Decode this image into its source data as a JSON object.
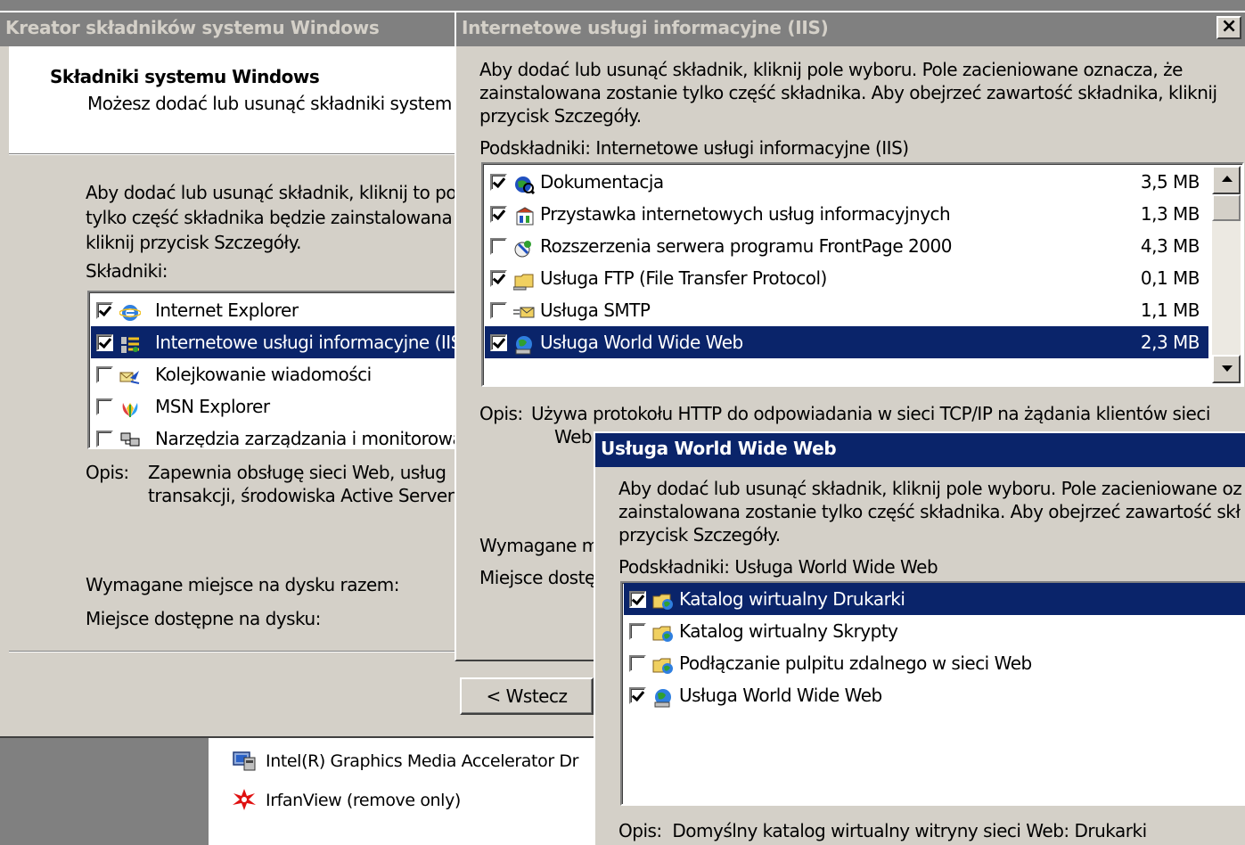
{
  "wizard": {
    "title": "Kreator składników systemu Windows",
    "header_title": "Składniki systemu Windows",
    "header_subtitle": "Możesz dodać lub usunąć składniki system",
    "intro_line1": "Aby dodać lub usunąć składnik, kliknij to po",
    "intro_line2": "tylko część składnika będzie zainstalowana",
    "intro_line3": "kliknij przycisk Szczegóły.",
    "components_label": "Składniki:",
    "components": [
      {
        "label": "Internet Explorer",
        "checked": true,
        "icon": "internet-explorer-icon"
      },
      {
        "label": "Internetowe usługi informacyjne (IIS",
        "checked": true,
        "icon": "iis-icon",
        "selected": true
      },
      {
        "label": "Kolejkowanie wiadomości",
        "checked": false,
        "icon": "message-queue-icon"
      },
      {
        "label": "MSN Explorer",
        "checked": false,
        "icon": "msn-butterfly-icon"
      },
      {
        "label": "Narzędzia zarządzania i monitorowa",
        "checked": false,
        "icon": "management-tools-icon"
      }
    ],
    "desc_label": "Opis:",
    "desc_line1": "Zapewnia obsługę sieci Web, usług",
    "desc_line2": "transakcji, środowiska Active Server",
    "disk_required": "Wymagane miejsce na dysku razem:",
    "disk_available": "Miejsce dostępne na dysku:",
    "back_button": "< Wstecz"
  },
  "background_list": {
    "items": [
      {
        "label": "Intel(R) Graphics Media Accelerator Dr",
        "icon": "intel-graphics-icon"
      },
      {
        "label": "IrfanView (remove only)",
        "icon": "irfanview-icon"
      }
    ]
  },
  "iis": {
    "title": "Internetowe usługi informacyjne (IIS)",
    "close_label": "×",
    "intro_line1": "Aby dodać lub usunąć składnik, kliknij pole wyboru. Pole zacieniowane oznacza, że",
    "intro_line2": "zainstalowana zostanie tylko część składnika. Aby obejrzeć zawartość składnika, kliknij",
    "intro_line3": "przycisk Szczegóły.",
    "sub_label": "Podskładniki: Internetowe usługi informacyjne (IIS)",
    "items": [
      {
        "label": "Dokumentacja",
        "size": "3,5 MB",
        "checked": true,
        "icon": "documentation-icon"
      },
      {
        "label": "Przystawka internetowych usług informacyjnych",
        "size": "1,3 MB",
        "checked": true,
        "icon": "snap-in-icon"
      },
      {
        "label": "Rozszerzenia serwera programu FrontPage 2000",
        "size": "4,3 MB",
        "checked": false,
        "icon": "frontpage-icon"
      },
      {
        "label": "Usługa FTP (File Transfer Protocol)",
        "size": "0,1 MB",
        "checked": true,
        "icon": "ftp-folder-icon"
      },
      {
        "label": "Usługa SMTP",
        "size": "1,1 MB",
        "checked": false,
        "icon": "smtp-mail-icon"
      },
      {
        "label": "Usługa World Wide Web",
        "size": "2,3 MB",
        "checked": true,
        "icon": "www-globe-icon",
        "selected": true
      }
    ],
    "desc_label": "Opis:",
    "desc_line1": "Używa protokołu HTTP do odpowiadania w sieci TCP/IP na żądania klientów sieci",
    "desc_line2": "Web",
    "disk_required": "Wymagane m",
    "disk_available": "Miejsce dostę"
  },
  "www": {
    "title": "Usługa World Wide Web",
    "intro_line1": "Aby dodać lub usunąć składnik, kliknij pole wyboru. Pole zacieniowane oz",
    "intro_line2": "zainstalowana zostanie tylko część składnika. Aby obejrzeć zawartość skł",
    "intro_line3": "przycisk Szczegóły.",
    "sub_label": "Podskładniki: Usługa World Wide Web",
    "items": [
      {
        "label": "Katalog wirtualny Drukarki",
        "checked": true,
        "icon": "virtual-folder-icon",
        "selected": true
      },
      {
        "label": "Katalog wirtualny Skrypty",
        "checked": false,
        "icon": "virtual-folder-icon"
      },
      {
        "label": "Podłączanie pulpitu zdalnego w sieci Web",
        "checked": false,
        "icon": "virtual-folder-icon"
      },
      {
        "label": "Usługa World Wide Web",
        "checked": true,
        "icon": "www-globe-icon"
      }
    ],
    "desc": "Opis:  Domyślny katalog wirtualny witryny sieci Web: Drukarki"
  }
}
